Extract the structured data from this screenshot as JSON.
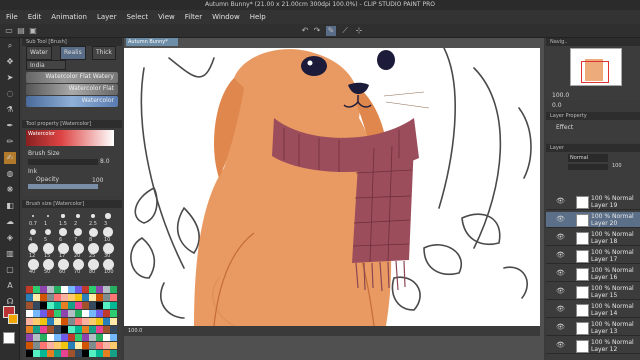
{
  "window": {
    "title": "Autumn Bunny* (21.00 x 21.00cm 300dpi 100.0%) - CLIP STUDIO PAINT PRO"
  },
  "menu": [
    "File",
    "Edit",
    "Animation",
    "Layer",
    "Select",
    "View",
    "Filter",
    "Window",
    "Help"
  ],
  "document_tab": "Autumn Bunny*",
  "sub_tool": {
    "header": "Sub Tool [Brush]",
    "tabs": [
      "Water",
      "Realis",
      "Thick"
    ],
    "subtab": "India",
    "brushes": [
      "Watercolor Flat Watery",
      "Watercolor Flat",
      "Watercolor"
    ]
  },
  "tool_property": {
    "header": "Tool property [Watercolor]",
    "brush_name": "Watercolor",
    "brush_size_label": "Brush Size",
    "brush_size_value": "8.0",
    "ink_label": "Ink",
    "opacity_label": "Opacity",
    "opacity_value": "100"
  },
  "brush_size": {
    "header": "Brush size [Watercolor]",
    "sizes": [
      "0.7",
      "1",
      "1.5",
      "2",
      "2.5",
      "3",
      "4",
      "5",
      "6",
      "7",
      "8",
      "10",
      "12",
      "15",
      "17",
      "20",
      "25",
      "30",
      "40",
      "50",
      "60",
      "70",
      "80",
      "100"
    ]
  },
  "navigator": {
    "zoom": "100.0",
    "angle": "0.0"
  },
  "layer_property": {
    "header": "Layer Property",
    "effect": "Effect"
  },
  "layer_panel": {
    "header": "Layer",
    "blend": "Normal",
    "opacity": "100",
    "layers": [
      {
        "percent": "100 %",
        "mode": "Normal",
        "name": "Layer 19"
      },
      {
        "percent": "100 %",
        "mode": "Normal",
        "name": "Layer 20"
      },
      {
        "percent": "100 %",
        "mode": "Normal",
        "name": "Layer 18"
      },
      {
        "percent": "100 %",
        "mode": "Normal",
        "name": "Layer 17"
      },
      {
        "percent": "100 %",
        "mode": "Normal",
        "name": "Layer 16"
      },
      {
        "percent": "100 %",
        "mode": "Normal",
        "name": "Layer 15"
      },
      {
        "percent": "100 %",
        "mode": "Normal",
        "name": "Layer 14"
      },
      {
        "percent": "100 %",
        "mode": "Normal",
        "name": "Layer 13"
      },
      {
        "percent": "100 %",
        "mode": "Normal",
        "name": "Layer 12"
      }
    ]
  },
  "status": {
    "zoom": "100.0"
  },
  "colors": {
    "fur": "#e8955a",
    "scarf": "#9c4d5c",
    "selection": "#5b6f88",
    "active_brush": "#5a7bb0"
  }
}
